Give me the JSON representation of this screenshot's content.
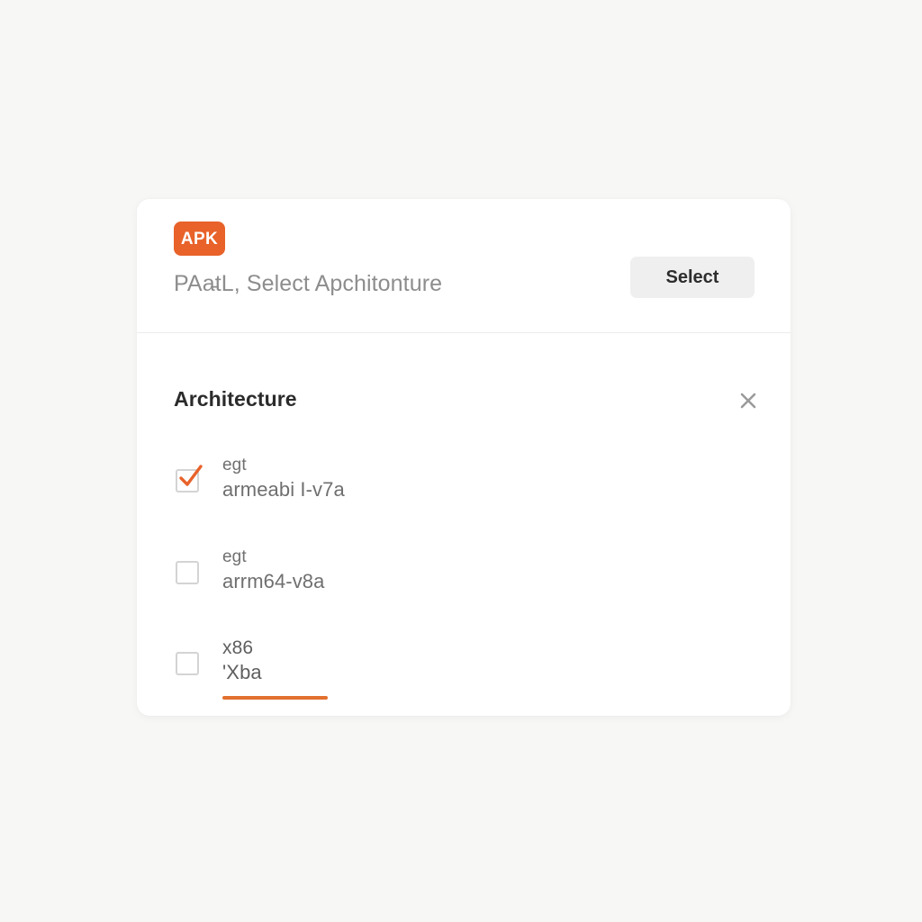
{
  "background_color": "#f7f7f6",
  "accent_color": "#e8622a",
  "card": {
    "header": {
      "badge_label": "APK",
      "badge_color": "#e8622a",
      "subtitle": "PAa̵tL, Select Apchitonture",
      "select_button_label": "Select"
    },
    "body": {
      "title": "Architecture",
      "close_icon": "close-icon",
      "options": [
        {
          "primary": "egt",
          "secondary": "armeabi I-v7a",
          "checked": true
        },
        {
          "primary": "egt",
          "secondary": "arrm64-v8a",
          "checked": false
        },
        {
          "primary": "x86",
          "secondary": "'Xba",
          "checked": false,
          "underline": true,
          "underline_color": "#e2702f"
        }
      ]
    }
  }
}
